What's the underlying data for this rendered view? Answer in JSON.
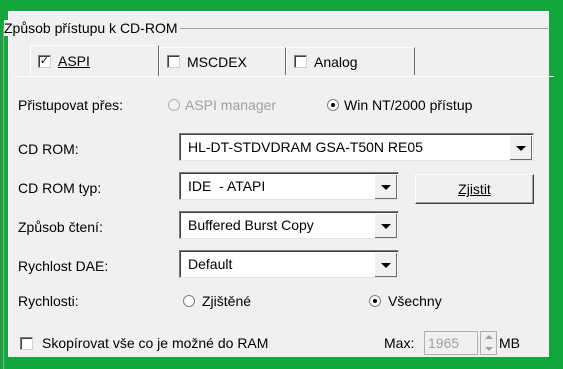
{
  "group_title": "Způsob přístupu k CD-ROM",
  "tabs": [
    {
      "label": "ASPI",
      "checked": true,
      "active": true
    },
    {
      "label": "MSCDEX",
      "checked": false,
      "active": false
    },
    {
      "label": "Analog",
      "checked": false,
      "active": false
    }
  ],
  "access": {
    "label": "Přistupovat přes:",
    "option_aspi": "ASPI manager",
    "option_win": "Win NT/2000 přístup",
    "selected": "Win NT/2000 přístup"
  },
  "cdrom": {
    "label": "CD ROM:",
    "value": "HL-DT-STDVDRAM GSA-T50N RE05"
  },
  "cdrom_type": {
    "label": "CD ROM typ:",
    "value": "IDE  - ATAPI",
    "detect_button": "Zjistit"
  },
  "read_method": {
    "label": "Způsob čtení:",
    "value": "Buffered Burst Copy"
  },
  "dae_speed": {
    "label": "Rychlost DAE:",
    "value": "Default"
  },
  "speeds": {
    "label": "Rychlosti:",
    "option_detected": "Zjištěné",
    "option_all": "Všechny",
    "selected": "Všechny"
  },
  "ram_copy": {
    "label": "Skopírovat vše co je možné do RAM",
    "checked": false,
    "max_label": "Max:",
    "max_value": "1965",
    "unit": "MB"
  },
  "colors": {
    "border_green": "#12a63c",
    "dialog_bg": "#f0f0f0"
  }
}
